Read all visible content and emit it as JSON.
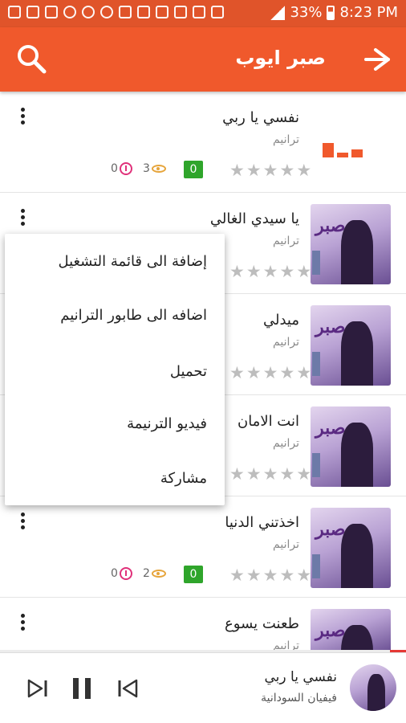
{
  "status": {
    "battery": "33%",
    "time": "8:23 PM"
  },
  "appbar": {
    "title": "صبر ايوب"
  },
  "songs": [
    {
      "title": "نفسي يا ربي",
      "category": "ترانيم",
      "rating": "0",
      "views": "3",
      "downloads": "0"
    },
    {
      "title": "يا سيدي الغالي",
      "category": "ترانيم"
    },
    {
      "title": "ميدلي",
      "category": "ترانيم"
    },
    {
      "title": "انت الامان",
      "category": "ترانيم"
    },
    {
      "title": "اخذتني الدنيا",
      "category": "ترانيم",
      "rating": "0",
      "views": "2",
      "downloads": "0"
    },
    {
      "title": "طعنت يسوع",
      "category": "ترانيم"
    }
  ],
  "menu": {
    "items": [
      "إضافة الى قائمة التشغيل",
      "اضافه الى طابور الترانيم",
      "تحميل",
      "فيديو الترنيمة",
      "مشاركة"
    ]
  },
  "player": {
    "title": "نفسي يا ربي",
    "artist": "فيفيان السودانية",
    "progress": 0.04
  },
  "colors": {
    "accent": "#f0592c",
    "rating_badge": "#2fa52b"
  }
}
